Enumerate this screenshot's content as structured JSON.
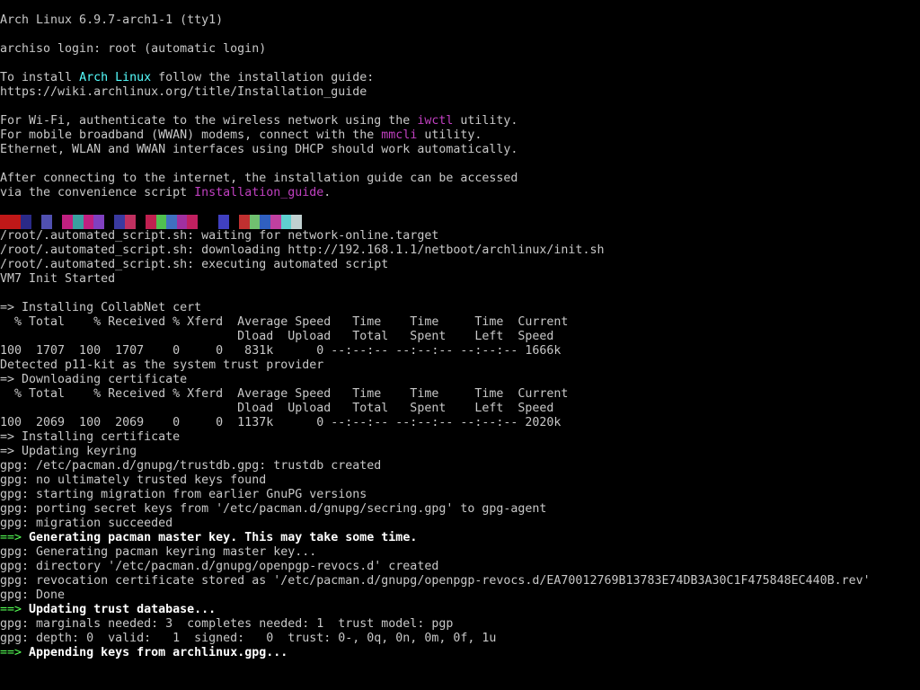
{
  "console": {
    "tty": "Arch Linux 6.9.7-arch1-1 (tty1)",
    "login": "archiso login: root (automatic login)",
    "lines": [
      [
        {
          "t": "Arch Linux 6.9.7-arch1-1 (tty1)"
        }
      ],
      [],
      [
        {
          "t": "archiso login: root (automatic login)"
        }
      ],
      [],
      [
        {
          "t": "To install "
        },
        {
          "t": "Arch Linux",
          "c": "cyan"
        },
        {
          "t": " follow the installation guide:"
        }
      ],
      [
        {
          "t": "https://wiki.archlinux.org/title/Installation_guide"
        }
      ],
      [],
      [
        {
          "t": "For Wi-Fi, authenticate to the wireless network using the "
        },
        {
          "t": "iwctl",
          "c": "magenta"
        },
        {
          "t": " utility."
        }
      ],
      [
        {
          "t": "For mobile broadband (WWAN) modems, connect with the "
        },
        {
          "t": "mmcli",
          "c": "magenta"
        },
        {
          "t": " utility."
        }
      ],
      [
        {
          "t": "Ethernet, WLAN and WWAN interfaces using DHCP should work automatically."
        }
      ],
      [],
      [
        {
          "t": "After connecting to the internet, the installation guide can be accessed"
        }
      ],
      [
        {
          "t": "via the convenience script "
        },
        {
          "t": "Installation_guide",
          "c": "magenta"
        },
        {
          "t": "."
        }
      ],
      [],
      "BANNER",
      [
        {
          "t": "/root/.automated_script.sh: waiting for network-online.target"
        }
      ],
      [
        {
          "t": "/root/.automated_script.sh: downloading http://192.168.1.1/netboot/archlinux/init.sh"
        }
      ],
      [
        {
          "t": "/root/.automated_script.sh: executing automated script"
        }
      ],
      [
        {
          "t": "VM7 Init Started"
        }
      ],
      [],
      [
        {
          "t": "=> Installing CollabNet cert"
        }
      ],
      [
        {
          "t": "  % Total    % Received % Xferd  Average Speed   Time    Time     Time  Current"
        }
      ],
      [
        {
          "t": "                                 Dload  Upload   Total   Spent    Left  Speed"
        }
      ],
      [
        {
          "t": "100  1707  100  1707    0     0   831k      0 --:--:-- --:--:-- --:--:-- 1666k"
        }
      ],
      [
        {
          "t": "Detected p11-kit as the system trust provider"
        }
      ],
      [
        {
          "t": "=> Downloading certificate"
        }
      ],
      [
        {
          "t": "  % Total    % Received % Xferd  Average Speed   Time    Time     Time  Current"
        }
      ],
      [
        {
          "t": "                                 Dload  Upload   Total   Spent    Left  Speed"
        }
      ],
      [
        {
          "t": "100  2069  100  2069    0     0  1137k      0 --:--:-- --:--:-- --:--:-- 2020k"
        }
      ],
      [
        {
          "t": "=> Installing certificate"
        }
      ],
      [
        {
          "t": "=> Updating keyring"
        }
      ],
      [
        {
          "t": "gpg: /etc/pacman.d/gnupg/trustdb.gpg: trustdb created"
        }
      ],
      [
        {
          "t": "gpg: no ultimately trusted keys found"
        }
      ],
      [
        {
          "t": "gpg: starting migration from earlier GnuPG versions"
        }
      ],
      [
        {
          "t": "gpg: porting secret keys from '/etc/pacman.d/gnupg/secring.gpg' to gpg-agent"
        }
      ],
      [
        {
          "t": "gpg: migration succeeded"
        }
      ],
      [
        {
          "t": "==>",
          "c": "green"
        },
        {
          "t": " Generating pacman master key. This may take some time.",
          "c": "bold"
        }
      ],
      [
        {
          "t": "gpg: Generating pacman keyring master key..."
        }
      ],
      [
        {
          "t": "gpg: directory '/etc/pacman.d/gnupg/openpgp-revocs.d' created"
        }
      ],
      [
        {
          "t": "gpg: revocation certificate stored as '/etc/pacman.d/gnupg/openpgp-revocs.d/EA70012769B13783E74DB3A30C1F475848EC440B.rev'"
        }
      ],
      [
        {
          "t": "gpg: Done"
        }
      ],
      [
        {
          "t": "==>",
          "c": "green"
        },
        {
          "t": " Updating trust database...",
          "c": "bold"
        }
      ],
      [
        {
          "t": "gpg: marginals needed: 3  completes needed: 1  trust model: pgp"
        }
      ],
      [
        {
          "t": "gpg: depth: 0  valid:   1  signed:   0  trust: 0-, 0q, 0n, 0m, 0f, 1u"
        }
      ],
      [
        {
          "t": "==>",
          "c": "green"
        },
        {
          "t": " Appending keys from archlinux.gpg...",
          "c": "bold"
        }
      ]
    ],
    "banner_colors": [
      "#c01818",
      "#c01818",
      "#2a2a88",
      "#000000",
      "#5050b0",
      "#000000",
      "#c02080",
      "#3aa0a0",
      "#c02080",
      "#8040c0",
      "#000000",
      "#3a3aa0",
      "#c03060",
      "#000000",
      "#c02050",
      "#50c050",
      "#4070c0",
      "#a030a0",
      "#c02060",
      "#000000",
      "#000000",
      "#4040c0",
      "#000000",
      "#c03030",
      "#70c070",
      "#3060c0",
      "#c040a0",
      "#5fd0d0",
      "#c0d0d0"
    ]
  }
}
